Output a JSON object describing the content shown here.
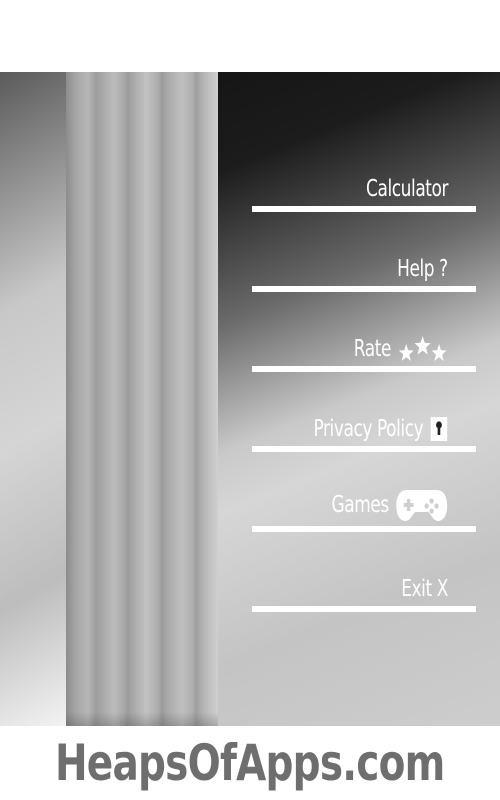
{
  "menu": {
    "items": [
      {
        "label": "Calculator",
        "icon": "none"
      },
      {
        "label": "Help ?",
        "icon": "none"
      },
      {
        "label": "Rate",
        "icon": "three-stars-icon"
      },
      {
        "label": "Privacy Policy",
        "icon": "keyhole-lock-icon"
      },
      {
        "label": "Games",
        "icon": "gamepad-icon"
      },
      {
        "label": "Exit X",
        "icon": "none"
      }
    ]
  },
  "footer": {
    "brand": "HeapsOfApps.com"
  },
  "colors": {
    "menu_text": "#ffffff",
    "footer_text": "#6e6e6e",
    "panel_dark": "#101010"
  }
}
